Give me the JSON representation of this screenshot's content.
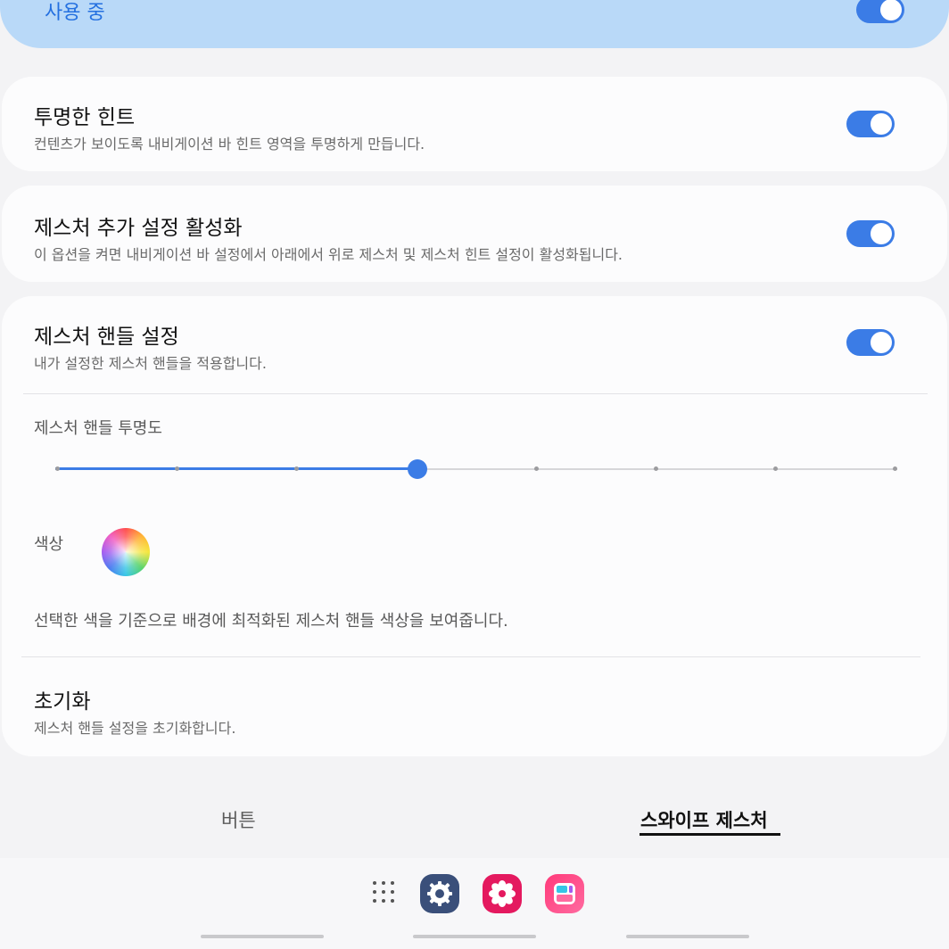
{
  "top_item": {
    "label": "사용 중"
  },
  "transparent_hint": {
    "title": "투명한 힌트",
    "description": "컨텐츠가 보이도록 내비게이션 바 힌트 영역을 투명하게 만듭니다."
  },
  "extra_gesture_settings": {
    "title": "제스처 추가 설정 활성화",
    "description": "이 옵션을 켜면 내비게이션 바 설정에서 아래에서 위로 제스처 및 제스처 힌트 설정이 활성화됩니다."
  },
  "gesture_handle": {
    "title": "제스처 핸들 설정",
    "description": "내가 설정한 제스처 핸들을 적용합니다.",
    "opacity_label": "제스처 핸들 투명도",
    "opacity_level": 0.43,
    "color_label": "색상",
    "color_description": "선택한 색을 기준으로 배경에 최적화된 제스처 핸들 색상을 보여줍니다."
  },
  "reset": {
    "title": "초기화",
    "description": "제스처 핸들 설정을 초기화합니다."
  },
  "tabs": {
    "buttons_label": "버튼",
    "swipe_label": "스와이프 제스처",
    "selected": "스와이프 제스처"
  },
  "dock": {
    "apps": [
      "app-grid-icon",
      "settings-icon",
      "blossom-icon",
      "widgets-icon"
    ]
  },
  "colors": {
    "accent": "#3b7ce6",
    "top_bar": "#b9d9f8",
    "background": "#f3f3f5"
  }
}
